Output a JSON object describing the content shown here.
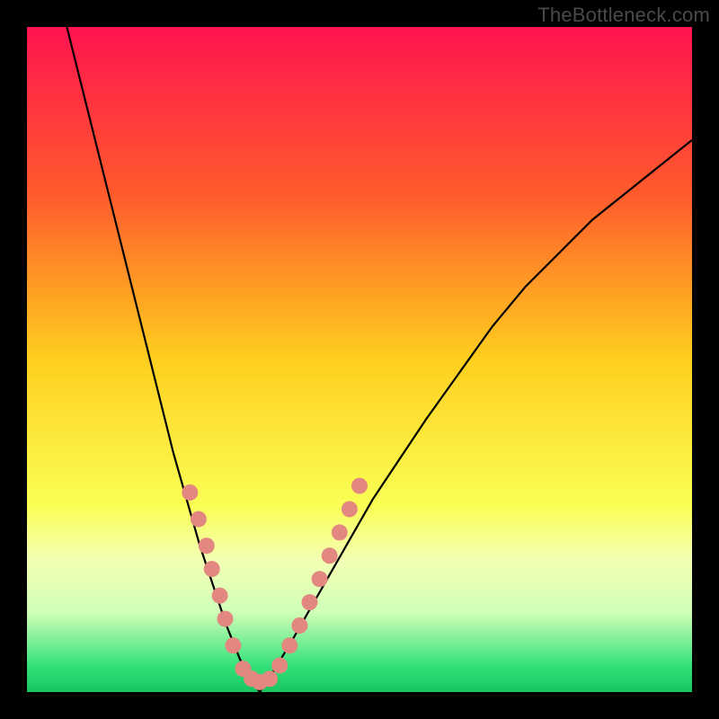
{
  "watermark": "TheBottleneck.com",
  "chart_data": {
    "type": "line",
    "title": "",
    "xlabel": "",
    "ylabel": "",
    "xlim": [
      0,
      100
    ],
    "ylim": [
      0,
      100
    ],
    "gradient_stops": [
      {
        "offset": 0,
        "color": "#ff1450"
      },
      {
        "offset": 25,
        "color": "#ff5a2c"
      },
      {
        "offset": 50,
        "color": "#ffcf1e"
      },
      {
        "offset": 72,
        "color": "#faff55"
      },
      {
        "offset": 80,
        "color": "#f4ffb3"
      },
      {
        "offset": 88,
        "color": "#d0ffb8"
      },
      {
        "offset": 96,
        "color": "#35e27a"
      },
      {
        "offset": 100,
        "color": "#18c45e"
      }
    ],
    "series": [
      {
        "name": "curve-left",
        "x": [
          6,
          8,
          10,
          12,
          14,
          16,
          18,
          20,
          22,
          24,
          26,
          28,
          30,
          32,
          33.5,
          35
        ],
        "y": [
          100,
          92,
          84,
          76,
          68,
          60,
          52,
          44,
          36,
          29,
          22,
          16,
          10,
          5,
          2,
          0
        ]
      },
      {
        "name": "curve-right",
        "x": [
          35,
          37,
          40,
          44,
          48,
          52,
          56,
          60,
          65,
          70,
          75,
          80,
          85,
          90,
          95,
          100
        ],
        "y": [
          0,
          3,
          8,
          15,
          22,
          29,
          35,
          41,
          48,
          55,
          61,
          66,
          71,
          75,
          79,
          83
        ]
      }
    ],
    "markers": {
      "name": "highlight-dots",
      "color": "#e38880",
      "radius": 9,
      "points": [
        {
          "x": 24.5,
          "y": 30
        },
        {
          "x": 25.8,
          "y": 26
        },
        {
          "x": 27.0,
          "y": 22
        },
        {
          "x": 27.8,
          "y": 18.5
        },
        {
          "x": 29.0,
          "y": 14.5
        },
        {
          "x": 29.8,
          "y": 11
        },
        {
          "x": 31.0,
          "y": 7
        },
        {
          "x": 32.5,
          "y": 3.5
        },
        {
          "x": 33.8,
          "y": 2
        },
        {
          "x": 35.0,
          "y": 1.5
        },
        {
          "x": 36.5,
          "y": 2
        },
        {
          "x": 38.0,
          "y": 4
        },
        {
          "x": 39.5,
          "y": 7
        },
        {
          "x": 41.0,
          "y": 10
        },
        {
          "x": 42.5,
          "y": 13.5
        },
        {
          "x": 44.0,
          "y": 17
        },
        {
          "x": 45.5,
          "y": 20.5
        },
        {
          "x": 47.0,
          "y": 24
        },
        {
          "x": 48.5,
          "y": 27.5
        },
        {
          "x": 50.0,
          "y": 31
        }
      ]
    }
  }
}
